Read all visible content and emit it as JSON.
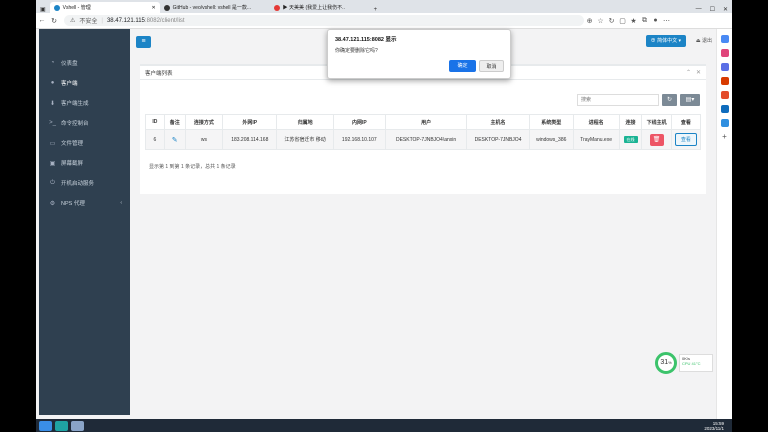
{
  "browser": {
    "tabs": [
      {
        "label": "Vshell - 管理",
        "active": true
      },
      {
        "label": "GitHub - veo/vshell: vshell 是一款...",
        "active": false
      },
      {
        "label": "▶ 天美美 (我爱上让我伤不..",
        "active": false
      }
    ],
    "new_tab": "+",
    "window_controls": [
      "—",
      "☐",
      "✕"
    ],
    "url_security": "不安全",
    "url_host": "38.47.121.115",
    "url_path": ":8082/client/list"
  },
  "sidebar": {
    "items": [
      {
        "label": "仪表盘",
        "icon": "dashboard-icon"
      },
      {
        "label": "客户端",
        "icon": "user-icon",
        "active": true
      },
      {
        "label": "客户端生成",
        "icon": "download-icon"
      },
      {
        "label": "命令控制台",
        "icon": "terminal-icon"
      },
      {
        "label": "文件管理",
        "icon": "folder-icon"
      },
      {
        "label": "屏幕截屏",
        "icon": "screen-icon"
      },
      {
        "label": "开机启动服务",
        "icon": "power-icon"
      },
      {
        "label": "NPS 代理",
        "icon": "proxy-icon",
        "caret": "‹"
      }
    ]
  },
  "topbar": {
    "menu_icon": "≡",
    "lang_label": "简体中文",
    "logout_label": "退出"
  },
  "panel": {
    "title": "客户端列表",
    "search_placeholder": "搜索",
    "columns": [
      "ID",
      "备注",
      "连接方式",
      "外网IP",
      "归属地",
      "内网IP",
      "用户",
      "主机名",
      "系统类型",
      "进程名",
      "连接",
      "下线主机",
      "查看"
    ],
    "rows": [
      {
        "id": "6",
        "conn_type": "ws",
        "wan_ip": "183.208.114.168",
        "location": "江苏省宿迁市 移动",
        "lan_ip": "192.168.10.107",
        "user": "DESKTOP-7JNBJO4\\anxin",
        "hostname": "DESKTOP-7JNBJO4",
        "os": "windows_386",
        "process": "TrayManu.exe",
        "status": "在线",
        "view": "查看"
      }
    ],
    "pager_text": "显示第 1 到第 1 条记录，总共 1 条记录"
  },
  "dialog": {
    "title": "38.47.121.115:8082 显示",
    "message": "你确定要删除它吗?",
    "ok": "确定",
    "cancel": "取消"
  },
  "cpu_widget": {
    "percent": "31",
    "percent_suffix": "%",
    "line1": "0K/s",
    "line2": "CPU 41°C"
  },
  "taskbar": {
    "time": "15:59",
    "date": "2023/11/1"
  },
  "colors": {
    "sidebar_bg": "#2f4050",
    "primary": "#1c84c6",
    "danger": "#ed5565",
    "online": "#1ab394"
  }
}
